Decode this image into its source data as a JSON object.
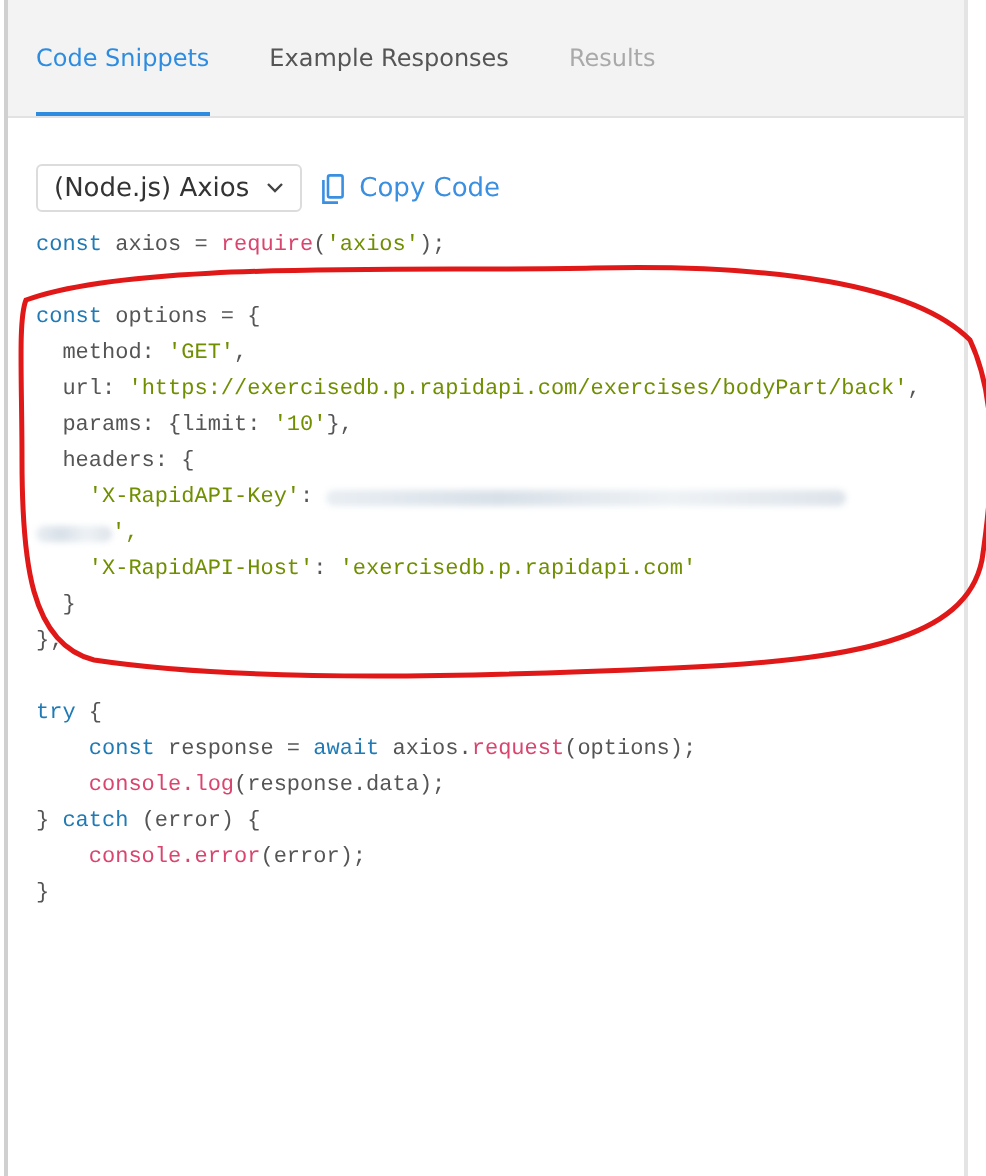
{
  "tabs": [
    {
      "label": "Code Snippets",
      "selected": true,
      "disabled": false
    },
    {
      "label": "Example Responses",
      "selected": false,
      "disabled": false
    },
    {
      "label": "Results",
      "selected": false,
      "disabled": true
    }
  ],
  "language_select": {
    "value": "(Node.js) Axios"
  },
  "copy_button": {
    "label": "Copy Code"
  },
  "code_blocks": [
    [
      [
        {
          "kind": "keyword",
          "text": "const"
        },
        {
          "kind": "plain",
          "text": " axios = "
        },
        {
          "kind": "function",
          "text": "require"
        },
        {
          "kind": "plain",
          "text": "("
        },
        {
          "kind": "string",
          "text": "'axios'"
        },
        {
          "kind": "plain",
          "text": ");"
        }
      ]
    ],
    [
      [
        {
          "kind": "keyword",
          "text": "const"
        },
        {
          "kind": "plain",
          "text": " options = {"
        }
      ],
      [
        {
          "kind": "plain",
          "text": "  method: "
        },
        {
          "kind": "string",
          "text": "'GET'"
        },
        {
          "kind": "plain",
          "text": ","
        }
      ],
      [
        {
          "kind": "plain",
          "text": "  url: "
        },
        {
          "kind": "string",
          "text": "'https://exercisedb.p.rapidapi.com/exercises/bodyPart/back'"
        },
        {
          "kind": "plain",
          "text": ","
        }
      ],
      [
        {
          "kind": "plain",
          "text": "  params: {limit: "
        },
        {
          "kind": "string",
          "text": "'10'"
        },
        {
          "kind": "plain",
          "text": "},"
        }
      ],
      [
        {
          "kind": "plain",
          "text": "  headers: {"
        }
      ],
      [
        {
          "kind": "string",
          "text": "    'X-RapidAPI-Key'"
        },
        {
          "kind": "plain",
          "text": ": "
        },
        {
          "kind": "redacted"
        }
      ],
      [
        {
          "kind": "redacted"
        },
        {
          "kind": "string",
          "text": "',"
        }
      ],
      [
        {
          "kind": "string",
          "text": "    'X-RapidAPI-Host'"
        },
        {
          "kind": "plain",
          "text": ": "
        },
        {
          "kind": "string",
          "text": "'exercisedb.p.rapidapi.com'"
        }
      ],
      [
        {
          "kind": "plain",
          "text": "  }"
        }
      ],
      [
        {
          "kind": "plain",
          "text": "};"
        }
      ]
    ],
    [
      [
        {
          "kind": "keyword",
          "text": "try"
        },
        {
          "kind": "plain",
          "text": " {"
        }
      ],
      [
        {
          "kind": "keyword",
          "text": "    const"
        },
        {
          "kind": "plain",
          "text": " response = "
        },
        {
          "kind": "keyword",
          "text": "await"
        },
        {
          "kind": "plain",
          "text": " axios."
        },
        {
          "kind": "function",
          "text": "request"
        },
        {
          "kind": "plain",
          "text": "(options);"
        }
      ],
      [
        {
          "kind": "function",
          "text": "    console.log"
        },
        {
          "kind": "plain",
          "text": "(response.data);"
        }
      ],
      [
        {
          "kind": "plain",
          "text": "} "
        },
        {
          "kind": "keyword",
          "text": "catch"
        },
        {
          "kind": "plain",
          "text": " (error) {"
        }
      ],
      [
        {
          "kind": "function",
          "text": "    console.error"
        },
        {
          "kind": "plain",
          "text": "(error);"
        }
      ],
      [
        {
          "kind": "plain",
          "text": "}"
        }
      ]
    ]
  ],
  "annotation": {
    "kind": "freehand-loop"
  }
}
